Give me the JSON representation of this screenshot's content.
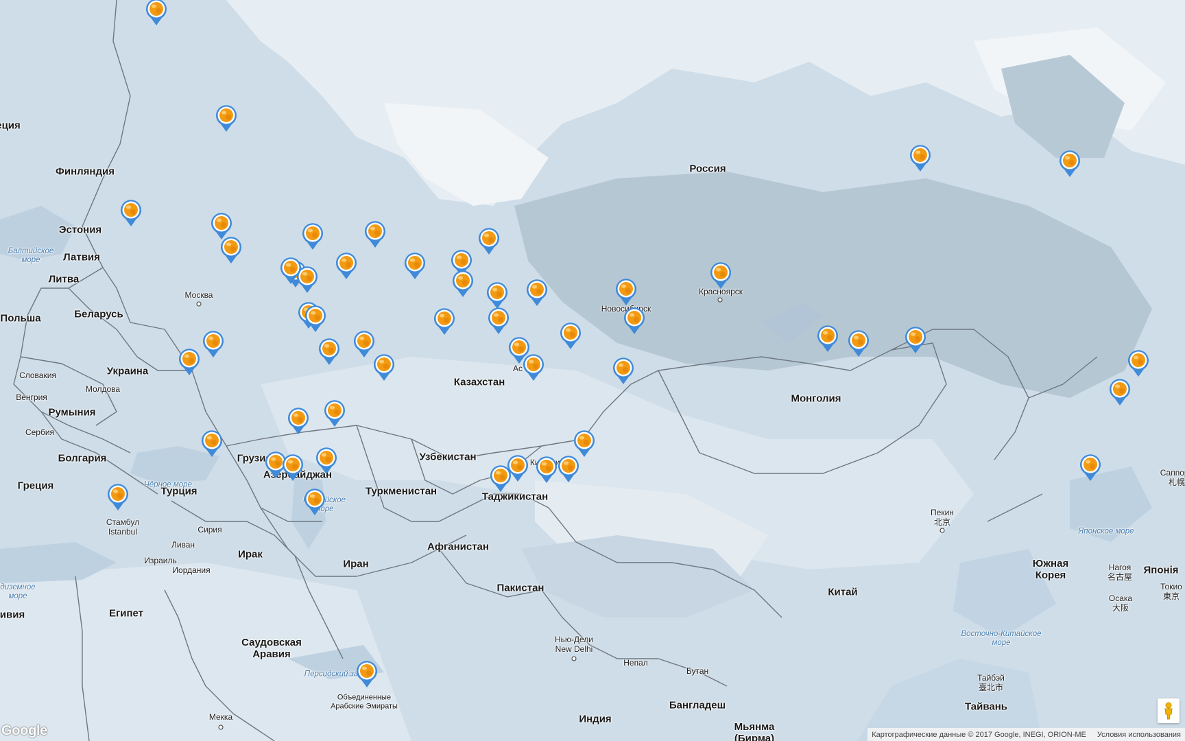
{
  "map": {
    "colors": {
      "land": "#cfdde8",
      "snow": "#eaf0f4",
      "forest": "#b9cad7",
      "border": "#6f7780",
      "marker_ring": "#3f8ad9",
      "marker_center": "#f29a12"
    },
    "labels": {
      "finland": "Финляндия",
      "russia": "Россия",
      "estonia": "Эстония",
      "latvia": "Латвия",
      "lithuania": "Литва",
      "poland": "Польша",
      "belarus": "Беларусь",
      "ukraine": "Украина",
      "slovakia": "Словакия",
      "hungary": "Венгрия",
      "moldova": "Молдова",
      "romania": "Румыния",
      "serbia": "Сербия",
      "bulgaria": "Болгария",
      "greece": "Греция",
      "turkey": "Турция",
      "georgia": "Грузия",
      "azerbaijan": "Азербайджан",
      "kazakhstan": "Казахстан",
      "uzbekistan": "Узбекистан",
      "kyrgyzstan": "Киргизия",
      "turkmenistan": "Туркменистан",
      "tajikistan": "Таджикистан",
      "mongolia": "Монголия",
      "afghanistan": "Афганистан",
      "iran": "Иран",
      "iraq": "Ирак",
      "syria": "Сирия",
      "lebanon": "Ливан",
      "israel": "Израиль",
      "jordan": "Иордания",
      "egypt": "Египет",
      "saudi_arabia": "Саудовская\nАравия",
      "uae": "Объединенные\nАрабские Эмираты",
      "pakistan": "Пакистан",
      "india": "Индия",
      "nepal": "Непал",
      "bhutan": "Бутан",
      "bangladesh": "Бангладеш",
      "myanmar": "Мьянма\n(Бирма)",
      "china": "Китай",
      "south_korea": "Южная\nКорея",
      "japan": "Японія",
      "left_cut_greece": "еция",
      "left_cut_libya": "ивия"
    },
    "cities": {
      "moscow": "Москва",
      "novosibirsk": "Новосибирск",
      "krasnoyarsk": "Красноярск",
      "istanbul": "Стамбул\nIstanbul",
      "beijing": "Пекин\n北京",
      "new_delhi": "Нью-Дели\nNew Delhi",
      "mecca": "Мекка",
      "nagoya": "Нагоя\n名古屋",
      "tokyo": "Токио\n東京",
      "osaka": "Осака\n大阪",
      "taipei": "Тайбэй\n臺北市",
      "taiwan": "Тайвань",
      "sapporo": "Саппоро\n札幌",
      "astana": "Ас"
    },
    "seas": {
      "baltic": "Балтийское\nморе",
      "black": "Чёрное море",
      "caspian": "Каспийское\nморе",
      "mediterranean": "диземное\nморе",
      "persian_gulf": "Персидский за",
      "japan_sea": "Японское море",
      "east_china": "Восточно-Китайское\nморе"
    },
    "markers_count": 60
  },
  "footer": {
    "logo": "Google",
    "attribution": "Картографические данные © 2017 Google, INEGI, ORION-ME",
    "terms": "Условия использования"
  },
  "icons": {
    "marker": "map-pin-icon",
    "pegman": "street-view-pegman-icon"
  }
}
